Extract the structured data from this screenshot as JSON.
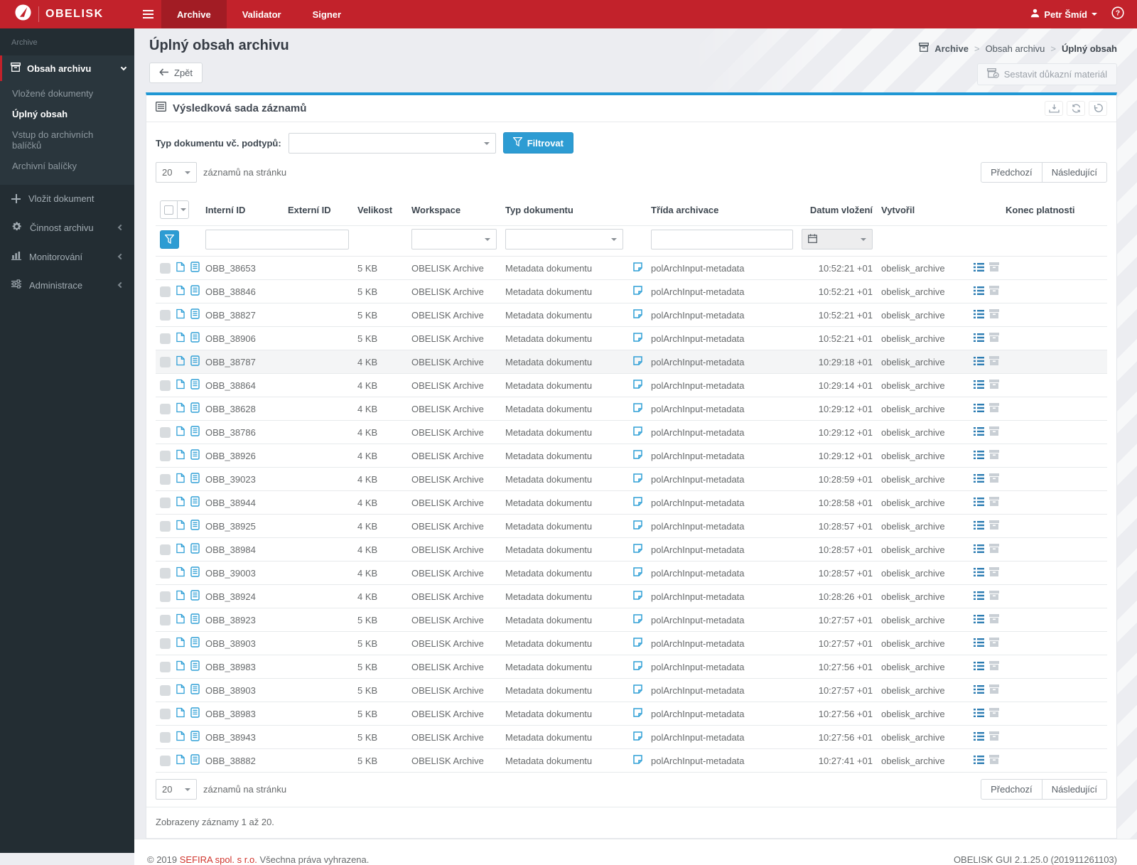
{
  "navbar": {
    "brand": "OBELISK",
    "tabs": [
      {
        "label": "Archive",
        "active": true
      },
      {
        "label": "Validator",
        "active": false
      },
      {
        "label": "Signer",
        "active": false
      }
    ],
    "user": {
      "name": "Petr Šmíd"
    }
  },
  "sidebar": {
    "section_label": "Archive",
    "group_label": "Obsah archivu",
    "submenu": [
      {
        "label": "Vložené dokumenty",
        "active": false
      },
      {
        "label": "Úplný obsah",
        "active": true
      },
      {
        "label": "Vstup do archivních balíčků",
        "active": false
      },
      {
        "label": "Archivní balíčky",
        "active": false
      }
    ],
    "items": [
      {
        "label": "Vložit dokument"
      },
      {
        "label": "Činnost archivu"
      },
      {
        "label": "Monitorování"
      },
      {
        "label": "Administrace"
      }
    ]
  },
  "header": {
    "title": "Úplný obsah archivu",
    "back_label": "Zpět",
    "breadcrumb": [
      {
        "label": "Archive"
      },
      {
        "label": "Obsah archivu"
      },
      {
        "label": "Úplný obsah"
      }
    ],
    "breadcrumb_separator": ">",
    "evidence_button": "Sestavit důkazní materiál"
  },
  "panel": {
    "title": "Výsledková sada záznamů",
    "doc_type_filter_label": "Typ dokumentu vč. podtypů:",
    "filter_button": "Filtrovat",
    "page_size": "20",
    "page_size_label": "záznamů na stránku",
    "prev_label": "Předchozí",
    "next_label": "Následující",
    "columns": [
      "Interní ID",
      "Externí ID",
      "Velikost",
      "Workspace",
      "Typ dokumentu",
      "Třída archivace",
      "Datum vložení",
      "Vytvořil",
      "Konec platnosti"
    ],
    "rows": [
      {
        "internal_id": "OBB_38653",
        "external_id": "",
        "size": "5 KB",
        "workspace": "OBELISK Archive",
        "doc_type": "Metadata dokumentu",
        "arch_class": "polArchInput-metadata",
        "inserted": "10:52:21 +01",
        "creator": "obelisk_archive",
        "expiry": "",
        "highlighted": false
      },
      {
        "internal_id": "OBB_38846",
        "external_id": "",
        "size": "5 KB",
        "workspace": "OBELISK Archive",
        "doc_type": "Metadata dokumentu",
        "arch_class": "polArchInput-metadata",
        "inserted": "10:52:21 +01",
        "creator": "obelisk_archive",
        "expiry": "",
        "highlighted": false
      },
      {
        "internal_id": "OBB_38827",
        "external_id": "",
        "size": "5 KB",
        "workspace": "OBELISK Archive",
        "doc_type": "Metadata dokumentu",
        "arch_class": "polArchInput-metadata",
        "inserted": "10:52:21 +01",
        "creator": "obelisk_archive",
        "expiry": "",
        "highlighted": false
      },
      {
        "internal_id": "OBB_38906",
        "external_id": "",
        "size": "5 KB",
        "workspace": "OBELISK Archive",
        "doc_type": "Metadata dokumentu",
        "arch_class": "polArchInput-metadata",
        "inserted": "10:52:21 +01",
        "creator": "obelisk_archive",
        "expiry": "",
        "highlighted": false
      },
      {
        "internal_id": "OBB_38787",
        "external_id": "",
        "size": "4 KB",
        "workspace": "OBELISK Archive",
        "doc_type": "Metadata dokumentu",
        "arch_class": "polArchInput-metadata",
        "inserted": "10:29:18 +01",
        "creator": "obelisk_archive",
        "expiry": "",
        "highlighted": true
      },
      {
        "internal_id": "OBB_38864",
        "external_id": "",
        "size": "4 KB",
        "workspace": "OBELISK Archive",
        "doc_type": "Metadata dokumentu",
        "arch_class": "polArchInput-metadata",
        "inserted": "10:29:14 +01",
        "creator": "obelisk_archive",
        "expiry": "",
        "highlighted": false
      },
      {
        "internal_id": "OBB_38628",
        "external_id": "",
        "size": "4 KB",
        "workspace": "OBELISK Archive",
        "doc_type": "Metadata dokumentu",
        "arch_class": "polArchInput-metadata",
        "inserted": "10:29:12 +01",
        "creator": "obelisk_archive",
        "expiry": "",
        "highlighted": false
      },
      {
        "internal_id": "OBB_38786",
        "external_id": "",
        "size": "4 KB",
        "workspace": "OBELISK Archive",
        "doc_type": "Metadata dokumentu",
        "arch_class": "polArchInput-metadata",
        "inserted": "10:29:12 +01",
        "creator": "obelisk_archive",
        "expiry": "",
        "highlighted": false
      },
      {
        "internal_id": "OBB_38926",
        "external_id": "",
        "size": "4 KB",
        "workspace": "OBELISK Archive",
        "doc_type": "Metadata dokumentu",
        "arch_class": "polArchInput-metadata",
        "inserted": "10:29:12 +01",
        "creator": "obelisk_archive",
        "expiry": "",
        "highlighted": false
      },
      {
        "internal_id": "OBB_39023",
        "external_id": "",
        "size": "4 KB",
        "workspace": "OBELISK Archive",
        "doc_type": "Metadata dokumentu",
        "arch_class": "polArchInput-metadata",
        "inserted": "10:28:59 +01",
        "creator": "obelisk_archive",
        "expiry": "",
        "highlighted": false
      },
      {
        "internal_id": "OBB_38944",
        "external_id": "",
        "size": "4 KB",
        "workspace": "OBELISK Archive",
        "doc_type": "Metadata dokumentu",
        "arch_class": "polArchInput-metadata",
        "inserted": "10:28:58 +01",
        "creator": "obelisk_archive",
        "expiry": "",
        "highlighted": false
      },
      {
        "internal_id": "OBB_38925",
        "external_id": "",
        "size": "4 KB",
        "workspace": "OBELISK Archive",
        "doc_type": "Metadata dokumentu",
        "arch_class": "polArchInput-metadata",
        "inserted": "10:28:57 +01",
        "creator": "obelisk_archive",
        "expiry": "",
        "highlighted": false
      },
      {
        "internal_id": "OBB_38984",
        "external_id": "",
        "size": "4 KB",
        "workspace": "OBELISK Archive",
        "doc_type": "Metadata dokumentu",
        "arch_class": "polArchInput-metadata",
        "inserted": "10:28:57 +01",
        "creator": "obelisk_archive",
        "expiry": "",
        "highlighted": false
      },
      {
        "internal_id": "OBB_39003",
        "external_id": "",
        "size": "4 KB",
        "workspace": "OBELISK Archive",
        "doc_type": "Metadata dokumentu",
        "arch_class": "polArchInput-metadata",
        "inserted": "10:28:57 +01",
        "creator": "obelisk_archive",
        "expiry": "",
        "highlighted": false
      },
      {
        "internal_id": "OBB_38924",
        "external_id": "",
        "size": "4 KB",
        "workspace": "OBELISK Archive",
        "doc_type": "Metadata dokumentu",
        "arch_class": "polArchInput-metadata",
        "inserted": "10:28:26 +01",
        "creator": "obelisk_archive",
        "expiry": "",
        "highlighted": false
      },
      {
        "internal_id": "OBB_38923",
        "external_id": "",
        "size": "5 KB",
        "workspace": "OBELISK Archive",
        "doc_type": "Metadata dokumentu",
        "arch_class": "polArchInput-metadata",
        "inserted": "10:27:57 +01",
        "creator": "obelisk_archive",
        "expiry": "",
        "highlighted": false
      },
      {
        "internal_id": "OBB_38903",
        "external_id": "",
        "size": "5 KB",
        "workspace": "OBELISK Archive",
        "doc_type": "Metadata dokumentu",
        "arch_class": "polArchInput-metadata",
        "inserted": "10:27:57 +01",
        "creator": "obelisk_archive",
        "expiry": "",
        "highlighted": false
      },
      {
        "internal_id": "OBB_38983",
        "external_id": "",
        "size": "5 KB",
        "workspace": "OBELISK Archive",
        "doc_type": "Metadata dokumentu",
        "arch_class": "polArchInput-metadata",
        "inserted": "10:27:56 +01",
        "creator": "obelisk_archive",
        "expiry": "",
        "highlighted": false
      },
      {
        "internal_id": "OBB_38903",
        "external_id": "",
        "size": "5 KB",
        "workspace": "OBELISK Archive",
        "doc_type": "Metadata dokumentu",
        "arch_class": "polArchInput-metadata",
        "inserted": "10:27:57 +01",
        "creator": "obelisk_archive",
        "expiry": "",
        "highlighted": false
      },
      {
        "internal_id": "OBB_38983",
        "external_id": "",
        "size": "5 KB",
        "workspace": "OBELISK Archive",
        "doc_type": "Metadata dokumentu",
        "arch_class": "polArchInput-metadata",
        "inserted": "10:27:56 +01",
        "creator": "obelisk_archive",
        "expiry": "",
        "highlighted": false
      },
      {
        "internal_id": "OBB_38943",
        "external_id": "",
        "size": "5 KB",
        "workspace": "OBELISK Archive",
        "doc_type": "Metadata dokumentu",
        "arch_class": "polArchInput-metadata",
        "inserted": "10:27:56 +01",
        "creator": "obelisk_archive",
        "expiry": "",
        "highlighted": false
      },
      {
        "internal_id": "OBB_38882",
        "external_id": "",
        "size": "5 KB",
        "workspace": "OBELISK Archive",
        "doc_type": "Metadata dokumentu",
        "arch_class": "polArchInput-metadata",
        "inserted": "10:27:41 +01",
        "creator": "obelisk_archive",
        "expiry": "",
        "highlighted": false
      }
    ],
    "summary": "Zobrazeny záznamy 1 až 20."
  },
  "footer": {
    "copyright_prefix": "© 2019 ",
    "company": "SEFIRA spol. s r.o.",
    "copyright_suffix": " Všechna práva vyhrazena.",
    "version": "OBELISK GUI 2.1.25.0 (201911261103)"
  },
  "colors": {
    "accent_red": "#c2222b",
    "accent_blue": "#2d9cd3",
    "link_red": "#d0342c"
  }
}
